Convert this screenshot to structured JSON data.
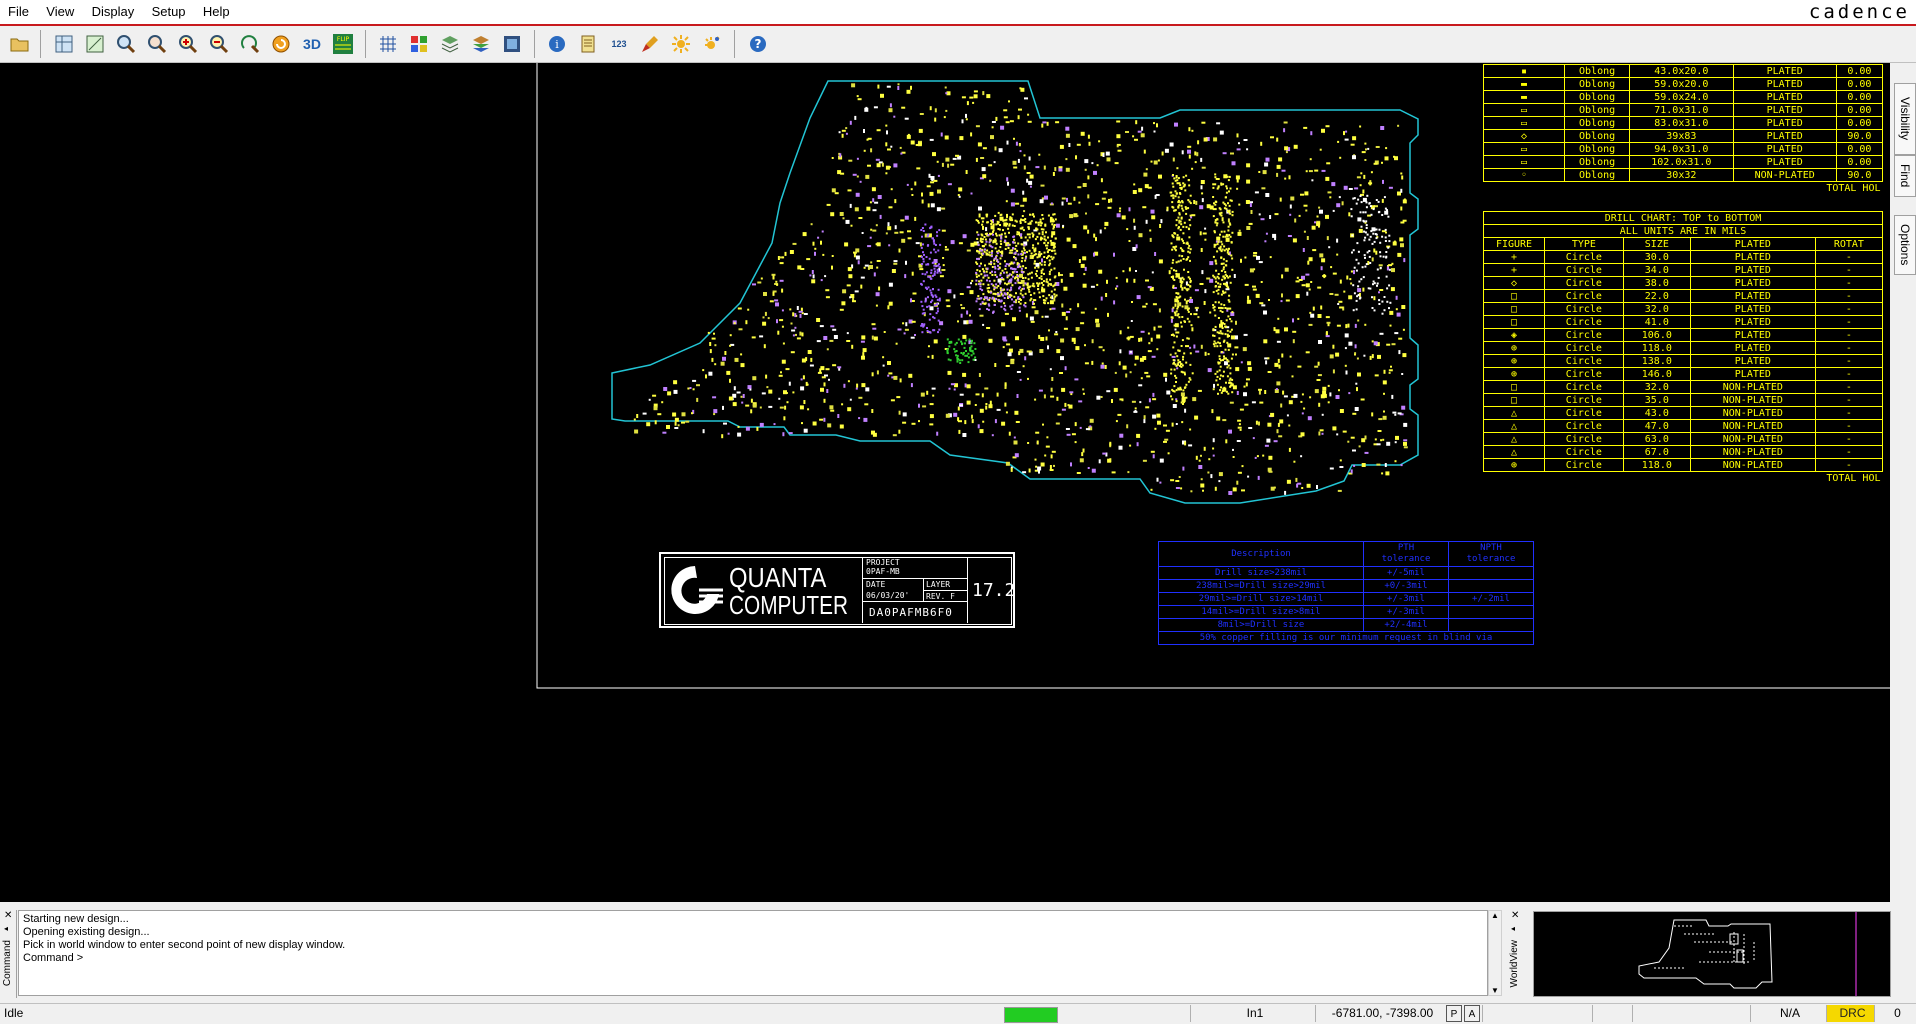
{
  "menu": [
    "File",
    "View",
    "Display",
    "Setup",
    "Help"
  ],
  "brand": "cadence",
  "toolbar_icons": [
    "open-icon",
    "zoom-fit-icon",
    "zoom-world-icon",
    "zoom-points-icon",
    "zoom-in-icon",
    "zoom-out-icon",
    "zoom-prev-icon",
    "zoom-center-icon",
    "redraw-icon",
    "3d-view-icon",
    "flip-icon",
    "grid-icon",
    "color-icon",
    "layer-icon",
    "stack-icon",
    "film-icon",
    "info-icon",
    "report-icon",
    "numbers-icon",
    "brush-icon",
    "sun-icon",
    "shadow-icon",
    "help-icon"
  ],
  "toolbar_labels": {
    "three_d": "3D",
    "flip": "FLIP",
    "numbers": "123"
  },
  "side_tabs": [
    "Visibility",
    "Find",
    "Options"
  ],
  "drill_top": {
    "rows": [
      [
        "Oblong",
        "43.0x20.0",
        "PLATED",
        "0.00"
      ],
      [
        "Oblong",
        "59.0x20.0",
        "PLATED",
        "0.00"
      ],
      [
        "Oblong",
        "59.0x24.0",
        "PLATED",
        "0.00"
      ],
      [
        "Oblong",
        "71.0x31.0",
        "PLATED",
        "0.00"
      ],
      [
        "Oblong",
        "83.0x31.0",
        "PLATED",
        "0.00"
      ],
      [
        "Oblong",
        "39x83",
        "PLATED",
        "90.0"
      ],
      [
        "Oblong",
        "94.0x31.0",
        "PLATED",
        "0.00"
      ],
      [
        "Oblong",
        "102.0x31.0",
        "PLATED",
        "0.00"
      ],
      [
        "Oblong",
        "30x32",
        "NON-PLATED",
        "90.0"
      ]
    ],
    "total": "TOTAL HOL"
  },
  "drill_chart": {
    "title": "DRILL CHART: TOP to BOTTOM",
    "units": "ALL UNITS ARE IN MILS",
    "headers": [
      "FIGURE",
      "TYPE",
      "SIZE",
      "PLATED",
      "ROTAT"
    ],
    "rows": [
      [
        "Circle",
        "30.0",
        "PLATED",
        "-"
      ],
      [
        "Circle",
        "34.0",
        "PLATED",
        "-"
      ],
      [
        "Circle",
        "38.0",
        "PLATED",
        "-"
      ],
      [
        "Circle",
        "22.0",
        "PLATED",
        "-"
      ],
      [
        "Circle",
        "32.0",
        "PLATED",
        "-"
      ],
      [
        "Circle",
        "41.0",
        "PLATED",
        "-"
      ],
      [
        "Circle",
        "106.0",
        "PLATED",
        "-"
      ],
      [
        "Circle",
        "118.0",
        "PLATED",
        "-"
      ],
      [
        "Circle",
        "138.0",
        "PLATED",
        "-"
      ],
      [
        "Circle",
        "146.0",
        "PLATED",
        "-"
      ],
      [
        "Circle",
        "32.0",
        "NON-PLATED",
        "-"
      ],
      [
        "Circle",
        "35.0",
        "NON-PLATED",
        "-"
      ],
      [
        "Circle",
        "43.0",
        "NON-PLATED",
        "-"
      ],
      [
        "Circle",
        "47.0",
        "NON-PLATED",
        "-"
      ],
      [
        "Circle",
        "63.0",
        "NON-PLATED",
        "-"
      ],
      [
        "Circle",
        "67.0",
        "NON-PLATED",
        "-"
      ],
      [
        "Circle",
        "118.0",
        "NON-PLATED",
        "-"
      ]
    ],
    "total": "TOTAL HOL"
  },
  "title_block": {
    "logo_top": "QUANTA",
    "logo_bottom": "COMPUTER",
    "project_label": "PROJECT",
    "project": "0PAF-MB",
    "date_label": "DATE",
    "date": "06/03/20'",
    "layer_label": "LAYER",
    "rev": "REV. F",
    "part": "DA0PAFMB6F0",
    "version": "17.2"
  },
  "tolerance": {
    "headers": [
      "Description",
      "PTH\ntolerance",
      "NPTH\ntolerance"
    ],
    "rows": [
      [
        "Drill size>238mil",
        "+/-5mil",
        ""
      ],
      [
        "238mil>=Drill size>29mil",
        "+0/-3mil",
        ""
      ],
      [
        "29mil>=Drill size>14mil",
        "+/-3mil",
        "+/-2mil"
      ],
      [
        "14mil>=Drill size>8mil",
        "+/-3mil",
        ""
      ],
      [
        "8mil>=Drill size",
        "+2/-4mil",
        ""
      ]
    ],
    "footer": "50% copper filling is our minimum request in blind via"
  },
  "command": {
    "label": "Command",
    "lines": [
      "Starting new design...",
      "Opening existing design...",
      "Pick in world window to enter second point of new display window.",
      "Command >"
    ]
  },
  "worldview_label": "WorldView",
  "status": {
    "state": "Idle",
    "layer": "In1",
    "coords": "-6781.00, -7398.00",
    "p": "P",
    "a": "A",
    "na": "N/A",
    "drc": "DRC",
    "drc_count": "0"
  }
}
